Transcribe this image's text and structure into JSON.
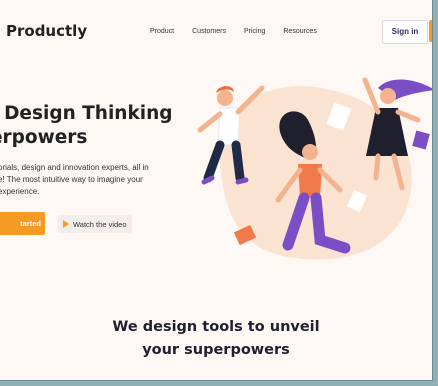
{
  "brand": {
    "logo": "Productly"
  },
  "nav": {
    "links": [
      "Product",
      "Customers",
      "Pricing",
      "Resources"
    ],
    "signin": "Sign in"
  },
  "hero": {
    "title_line1": "› Design Thinking",
    "title_line2": "erpowers",
    "desc_line1": "orials, design and innovation experts, all in",
    "desc_line2": "e! The most intuitive way to imagine your",
    "desc_line3": "experience.",
    "start_label": "tarted",
    "video_label": "Watch the video"
  },
  "section": {
    "line1": "We design tools to unveil",
    "line2": "your superpowers"
  },
  "colors": {
    "accent": "#f59a23",
    "text": "#222222",
    "navy": "#2b2f66",
    "blob": "#fbe3d1",
    "purple": "#7a4fc5"
  },
  "icons": {
    "play": "play-icon"
  }
}
